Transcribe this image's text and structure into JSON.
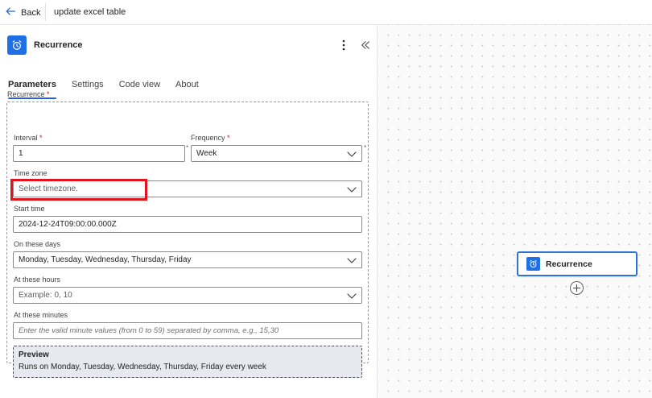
{
  "topbar": {
    "back_label": "Back",
    "flow_title": "update excel table"
  },
  "panel": {
    "title": "Recurrence",
    "tabs": [
      {
        "label": "Parameters",
        "active": true
      },
      {
        "label": "Settings"
      },
      {
        "label": "Code view"
      },
      {
        "label": "About"
      }
    ],
    "section_label": "Recurrence",
    "required_mark": "*",
    "fields": {
      "interval": {
        "label": "Interval",
        "value": "1"
      },
      "frequency": {
        "label": "Frequency",
        "value": "Week"
      },
      "timezone": {
        "label": "Time zone",
        "placeholder": "Select timezone."
      },
      "start_time": {
        "label": "Start time",
        "value": "2024-12-24T09:00:00.000Z"
      },
      "days": {
        "label": "On these days",
        "value": "Monday, Tuesday, Wednesday, Thursday, Friday"
      },
      "hours": {
        "label": "At these hours",
        "placeholder": "Example: 0, 10"
      },
      "minutes": {
        "label": "At these minutes",
        "placeholder": "Enter the valid minute values (from 0 to 59) separated by comma, e.g., 15,30"
      }
    },
    "preview": {
      "title": "Preview",
      "text": "Runs on Monday, Tuesday, Wednesday, Thursday, Friday every week"
    }
  },
  "canvas": {
    "node_label": "Recurrence"
  },
  "colors": {
    "accent": "#1f6fe5",
    "highlight": "#e1141b",
    "preview_bg": "#e8e8f1"
  },
  "icons": {
    "back": "arrow-left-icon",
    "app": "alarm-clock-icon",
    "more": "more-vertical-icon",
    "collapse": "double-chevron-left-icon",
    "dropdown": "chevron-down-icon",
    "add": "plus-circle-icon"
  }
}
